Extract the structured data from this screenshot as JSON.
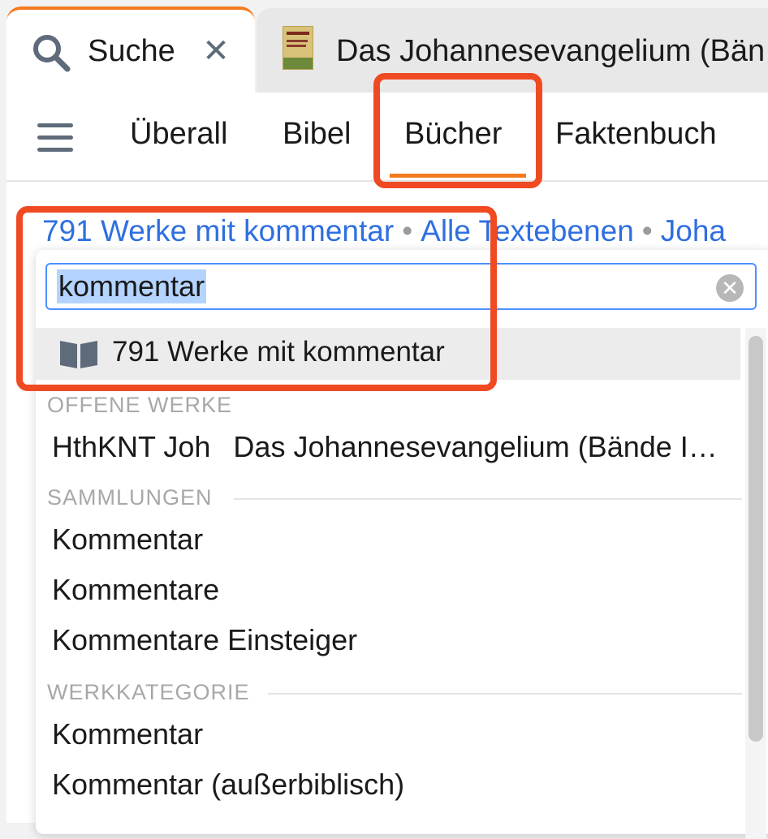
{
  "tabs": {
    "active": {
      "label": "Suche",
      "icon": "search-icon",
      "close": "✕"
    },
    "inactive": {
      "label": "Das Johannesevangelium (Bän",
      "icon": "book-cover-icon"
    }
  },
  "nav": {
    "menu_icon": "hamburger-menu-icon",
    "items": [
      "Überall",
      "Bibel",
      "Bücher",
      "Faktenbuch"
    ],
    "active": "Bücher"
  },
  "breadcrumbs": {
    "items": [
      "791 Werke mit kommentar",
      "Alle Textebenen",
      "Joha"
    ],
    "separator": "•"
  },
  "search": {
    "value": "kommentar",
    "clear_icon": "clear-icon"
  },
  "dropdown": {
    "results_label": "791 Werke mit kommentar",
    "sections": [
      {
        "title": "OFFENE WERKE",
        "items": [
          {
            "abbr": "HthKNT Joh",
            "title": "Das Johannesevangelium (Bände I…"
          }
        ]
      },
      {
        "title": "SAMMLUNGEN",
        "items": [
          "Kommentar",
          "Kommentare",
          "Kommentare Einsteiger"
        ]
      },
      {
        "title": "WERKKATEGORIE",
        "items": [
          "Kommentar",
          "Kommentar (außerbiblisch)"
        ]
      }
    ]
  },
  "colors": {
    "accent_orange": "#f47a1f",
    "link_blue": "#2f6fe0",
    "highlight_red": "#f04a23",
    "selection_blue": "#b4d4ff"
  }
}
